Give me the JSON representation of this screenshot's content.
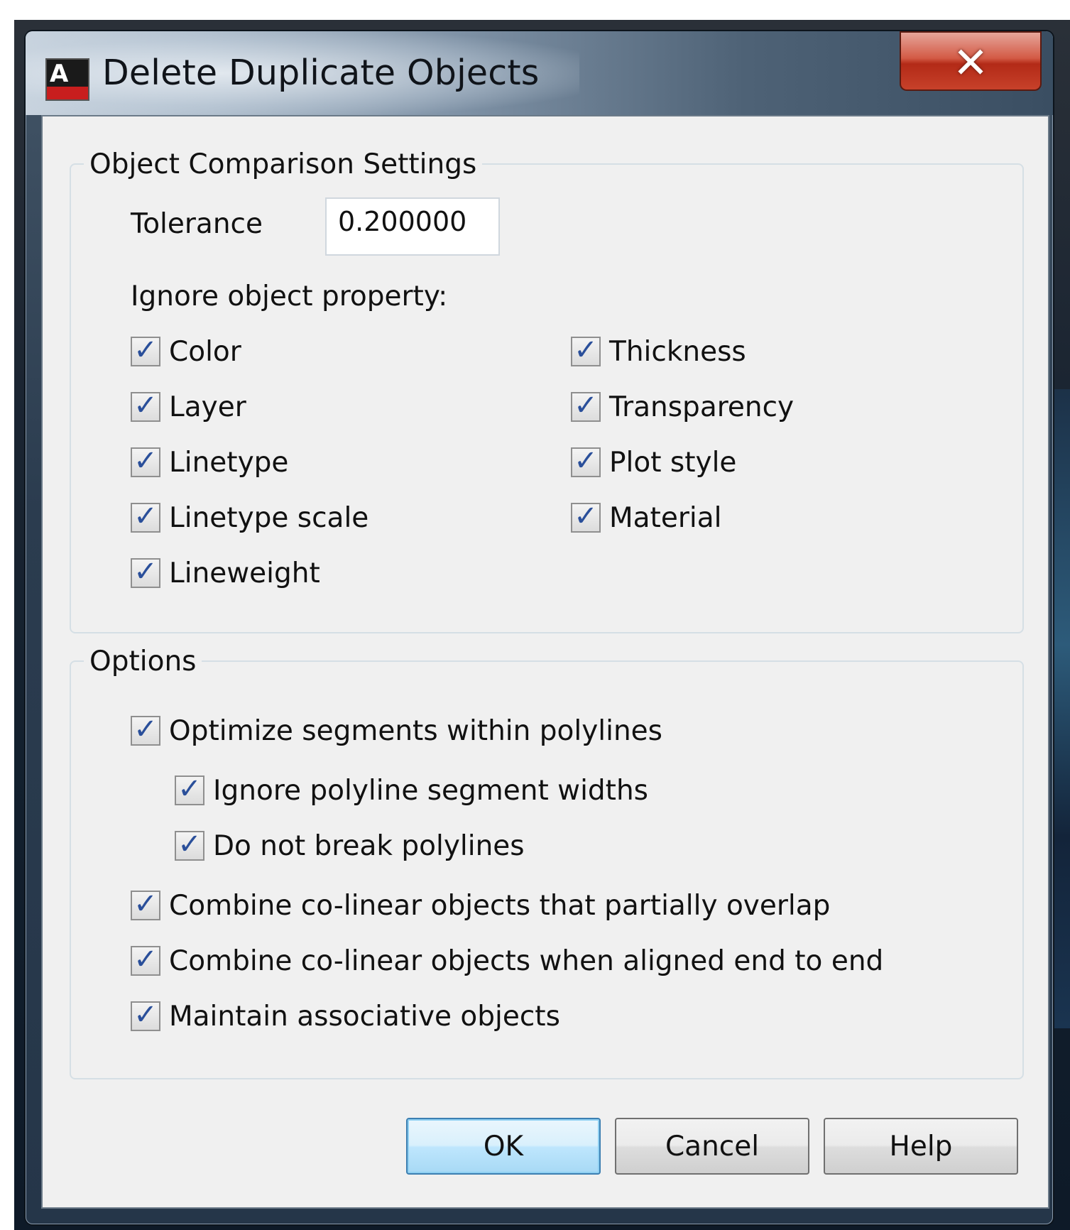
{
  "dialog": {
    "title": "Delete Duplicate Objects",
    "app_icon": "autocad-icon",
    "close_glyph": "✕",
    "close_icon": "close-icon"
  },
  "comparison": {
    "legend": "Object Comparison Settings",
    "tolerance_label": "Tolerance",
    "tolerance_value": "0.200000",
    "ignore_label": "Ignore object property:",
    "properties_left": [
      {
        "label": "Color",
        "checked": true
      },
      {
        "label": "Layer",
        "checked": true
      },
      {
        "label": "Linetype",
        "checked": true
      },
      {
        "label": "Linetype scale",
        "checked": true
      },
      {
        "label": "Lineweight",
        "checked": true
      }
    ],
    "properties_right": [
      {
        "label": "Thickness",
        "checked": true
      },
      {
        "label": "Transparency",
        "checked": true
      },
      {
        "label": "Plot style",
        "checked": true
      },
      {
        "label": "Material",
        "checked": true
      }
    ]
  },
  "options": {
    "legend": "Options",
    "items": [
      {
        "label": "Optimize segments within polylines",
        "checked": true,
        "indent": 0
      },
      {
        "label": "Ignore polyline segment widths",
        "checked": true,
        "indent": 1
      },
      {
        "label": "Do not break polylines",
        "checked": true,
        "indent": 1
      },
      {
        "label": "Combine co-linear objects that partially overlap",
        "checked": true,
        "indent": 0
      },
      {
        "label": "Combine co-linear objects when aligned end to end",
        "checked": true,
        "indent": 0
      },
      {
        "label": "Maintain associative objects",
        "checked": true,
        "indent": 0
      }
    ]
  },
  "buttons": {
    "ok": "OK",
    "cancel": "Cancel",
    "help": "Help"
  },
  "check_glyph": "✓"
}
